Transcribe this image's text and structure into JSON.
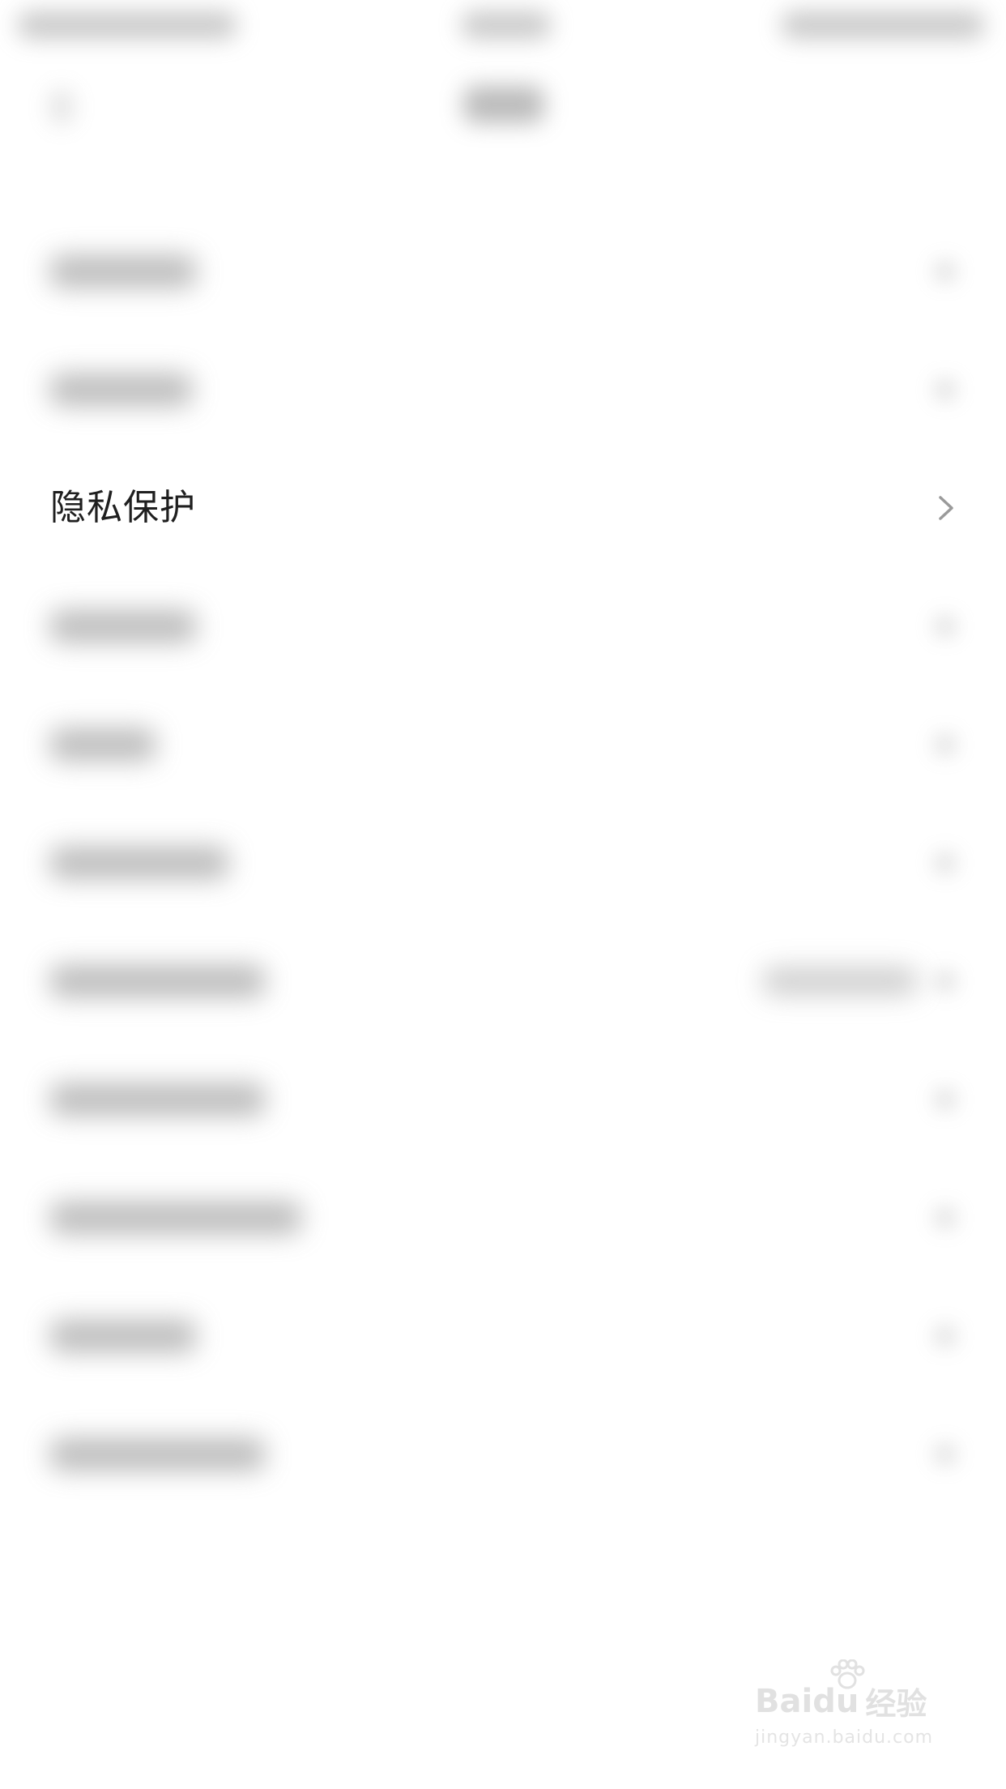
{
  "settings": {
    "privacy_label": "隐私保护"
  },
  "watermark": {
    "brand": "Baidu",
    "suffix": "经验",
    "url": "jingyan.baidu.com"
  },
  "icons": {
    "chevron": "chevron-right-icon",
    "paw": "baidu-paw-icon"
  },
  "colors": {
    "background": "#ffffff",
    "text": "#1f1f1f",
    "chevron": "#9a9a9a",
    "watermark": "#bdbdbd"
  }
}
